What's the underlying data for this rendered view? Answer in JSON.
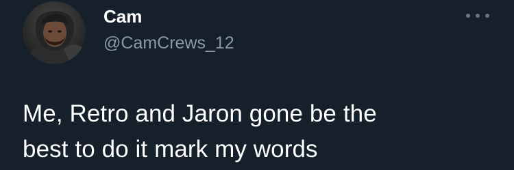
{
  "tweet": {
    "display_name": "Cam",
    "handle": "@CamCrews_12",
    "text": "Me, Retro and Jaron gone be the\nbest to do it mark my words",
    "more_icon": "more-horizontal-icon",
    "avatar_alt": "avatar"
  },
  "colors": {
    "background": "#15202b",
    "text": "#ffffff",
    "muted": "#8b98a5"
  }
}
